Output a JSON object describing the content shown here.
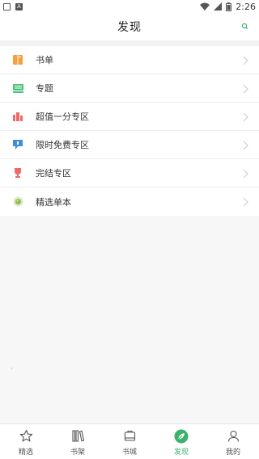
{
  "status_bar": {
    "time": "2:26"
  },
  "header": {
    "title": "发现"
  },
  "list": [
    {
      "label": "书单",
      "icon": "book-list-icon",
      "color": "#f5a03c"
    },
    {
      "label": "专题",
      "icon": "topic-icon",
      "color": "#4cc37a"
    },
    {
      "label": "超值一分专区",
      "icon": "bargain-icon",
      "color": "#ef6a6a"
    },
    {
      "label": "限时免费专区",
      "icon": "free-tag-icon",
      "color": "#3a8fd8"
    },
    {
      "label": "完结专区",
      "icon": "trophy-icon",
      "color": "#ef6a6a"
    },
    {
      "label": "精选单本",
      "icon": "badge-icon",
      "color": "#8bbf5a"
    }
  ],
  "nav": [
    {
      "label": "精选",
      "icon": "star-icon",
      "active": false
    },
    {
      "label": "书架",
      "icon": "bookshelf-icon",
      "active": false
    },
    {
      "label": "书城",
      "icon": "bookstore-icon",
      "active": false
    },
    {
      "label": "发现",
      "icon": "compass-leaf-icon",
      "active": true
    },
    {
      "label": "我的",
      "icon": "user-icon",
      "active": false
    }
  ],
  "colors": {
    "accent": "#3bb16c"
  }
}
